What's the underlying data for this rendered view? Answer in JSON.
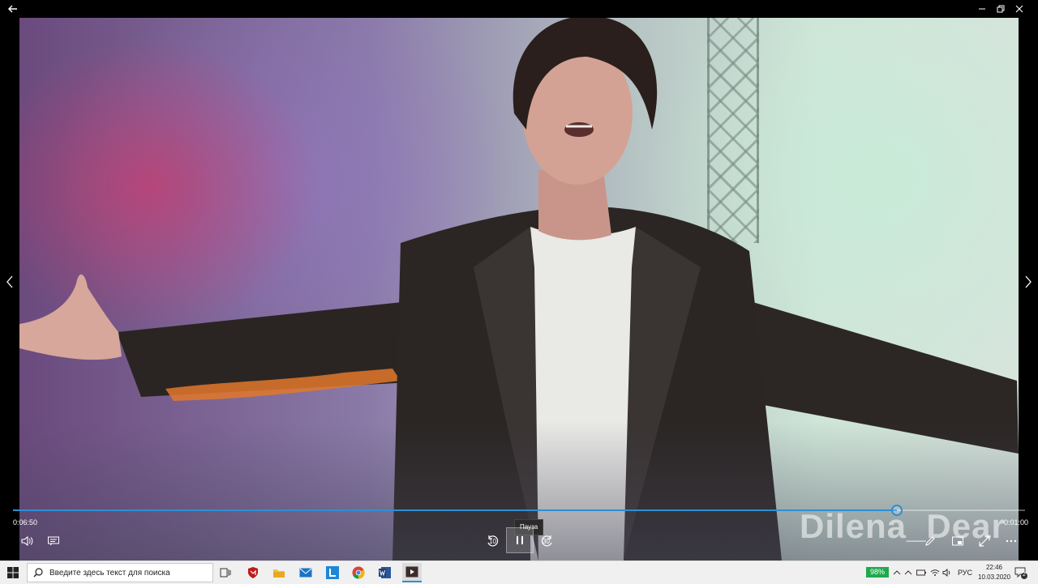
{
  "player": {
    "elapsed": "0:06:50",
    "remaining": "0:01:00",
    "progress": 0.873,
    "tooltip": "Пауза",
    "skip_back": "10",
    "skip_forward": "30",
    "watermark": "Dilena_Dear"
  },
  "taskbar": {
    "search_placeholder": "Введите здесь текст для поиска",
    "battery": "98%",
    "language": "РУС",
    "time": "22:46",
    "date": "10.03.2020",
    "notification_count": "2"
  },
  "colors": {
    "accent": "#2e8ed6",
    "battery": "#1faa4d"
  }
}
